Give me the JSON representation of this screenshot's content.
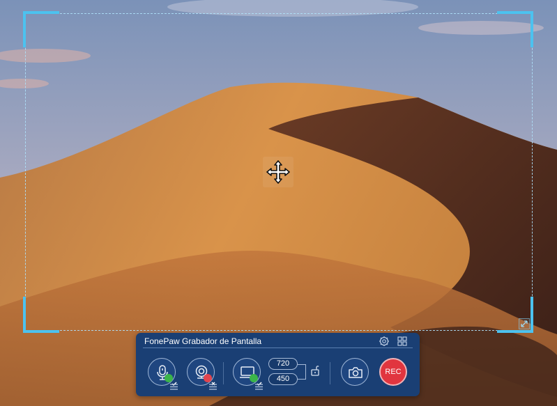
{
  "toolbar": {
    "title": "FonePaw Grabador de Pantalla",
    "width_value": "720",
    "height_value": "450",
    "rec_label": "REC"
  },
  "icons": {
    "move": "move-cross-arrows-icon",
    "resize": "resize-diagonal-icon",
    "settings": "gear-icon",
    "layout": "grid-icon",
    "microphone": "microphone-icon",
    "webcam": "webcam-icon",
    "display": "monitor-icon",
    "lock": "unlock-icon",
    "screenshot": "camera-icon"
  },
  "states": {
    "microphone_enabled": true,
    "webcam_enabled": false,
    "display_enabled": true,
    "aspect_locked": false
  },
  "colors": {
    "toolbar_bg": "#1a3f74",
    "frame_accent": "#4cc2ef",
    "rec_red": "#e1353f",
    "enabled_green": "#3bb54a",
    "disabled_red": "#e2454e"
  }
}
